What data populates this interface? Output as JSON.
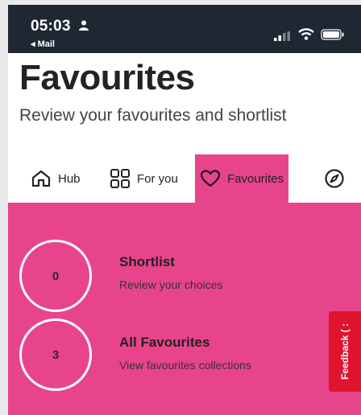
{
  "status_bar": {
    "time": "05:03",
    "back_label": "◂ Mail",
    "icons": [
      "person-icon",
      "signal-icon",
      "wifi-icon",
      "battery-icon"
    ]
  },
  "page": {
    "title": "Favourites",
    "subtitle": "Review your favourites and shortlist"
  },
  "tabs": [
    {
      "label": "Hub",
      "icon": "home-icon",
      "active": false
    },
    {
      "label": "For you",
      "icon": "grid-icon",
      "active": false
    },
    {
      "label": "Favourites",
      "icon": "heart-icon",
      "active": true
    },
    {
      "label": "",
      "icon": "compass-icon",
      "active": false
    }
  ],
  "items": [
    {
      "count": "0",
      "title": "Shortlist",
      "subtitle": "Review your choices"
    },
    {
      "count": "3",
      "title": "All Favourites",
      "subtitle": "View favourites collections"
    }
  ],
  "feedback": {
    "label": "Feedback ( :"
  },
  "colors": {
    "accent": "#e8448b",
    "status_bar": "#1e2732",
    "feedback": "#e0142e"
  }
}
